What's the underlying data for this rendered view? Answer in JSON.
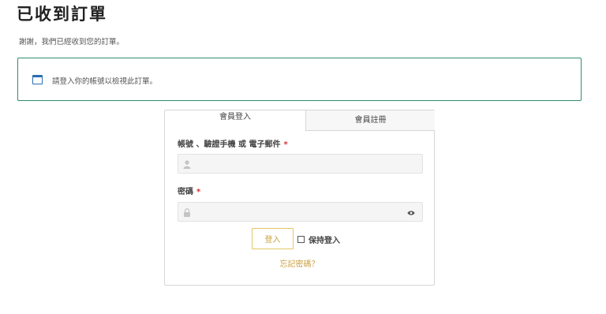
{
  "page": {
    "title": "已收到訂單",
    "thanks_text": "謝謝，我們已經收到您的訂單。"
  },
  "notice": {
    "icon": "window-icon",
    "text": "請登入你的帳號以檢視此訂單。",
    "border_color": "#2e8c6e"
  },
  "login": {
    "tabs": [
      {
        "label": "會員登入",
        "active": true
      },
      {
        "label": "會員註冊",
        "active": false
      }
    ],
    "username_label": "帳號 、驗證手機 或 電子郵件",
    "password_label": "密碼",
    "required_mark": "*",
    "username_value": "",
    "password_value": "",
    "login_button": "登入",
    "remember_label": "保持登入",
    "remember_checked": false,
    "forgot_link": "忘記密碼？",
    "accent_color": "#c8a13a"
  }
}
